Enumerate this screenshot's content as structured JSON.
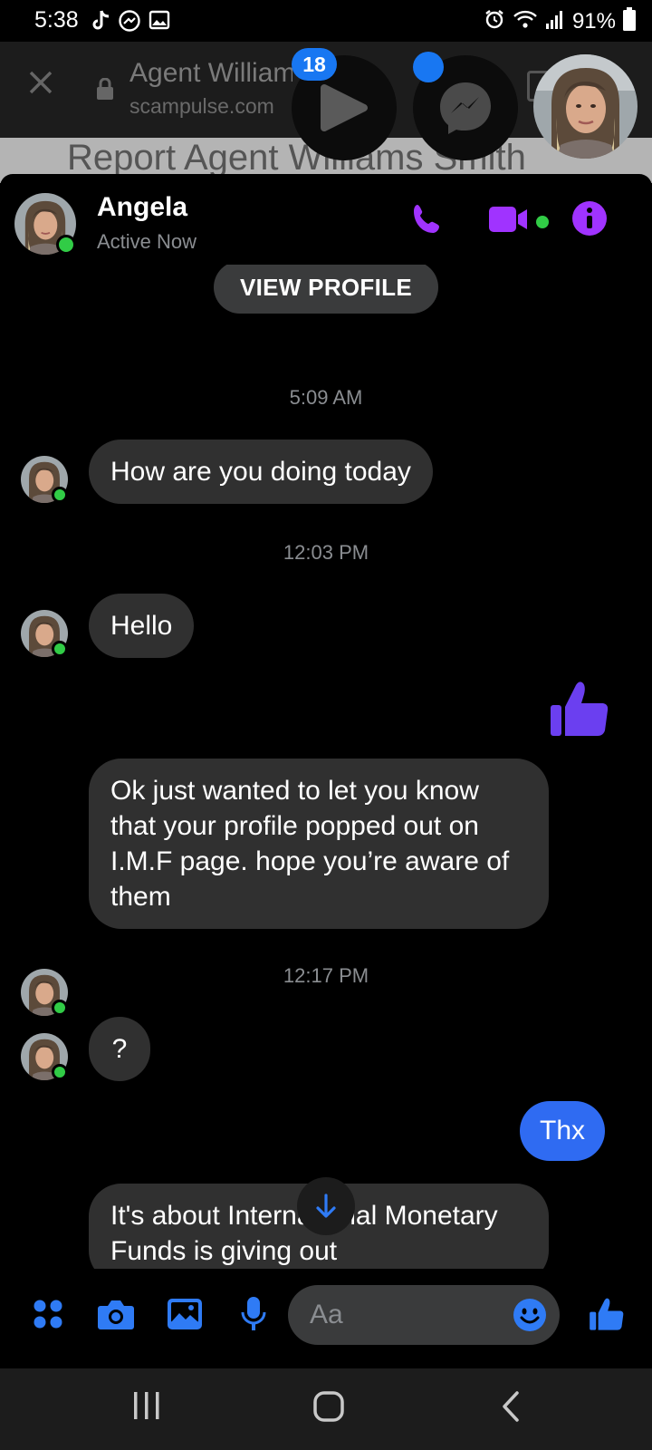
{
  "status_bar": {
    "time": "5:38",
    "battery": "91%",
    "left_icons": [
      "tiktok-icon",
      "messenger-icon",
      "image-icon"
    ],
    "right_icons": [
      "alarm-icon",
      "wifi-icon",
      "signal-icon",
      "battery-icon"
    ]
  },
  "browser": {
    "title": "Agent William",
    "url": "scampulse.com",
    "page_heading": "Report Agent Williams Smith"
  },
  "chat_heads": {
    "badge_count": "18"
  },
  "chat": {
    "contact_name": "Angela",
    "contact_status": "Active Now",
    "view_profile_label": "VIEW PROFILE",
    "accent_color": "#a033ff",
    "sent_color": "#2f6bf2",
    "received_color": "#303030",
    "online_color": "#31cc46",
    "messages": [
      {
        "type": "timestamp",
        "text": "5:09 AM"
      },
      {
        "type": "received",
        "text": "How are you doing today"
      },
      {
        "type": "timestamp",
        "text": "12:03 PM"
      },
      {
        "type": "received",
        "text": "Hello"
      },
      {
        "type": "sent_like",
        "icon": "thumbs-up-icon"
      },
      {
        "type": "received",
        "text": "Ok just wanted to let you know that your profile popped out on I.M.F page. hope you’re aware of them"
      },
      {
        "type": "timestamp",
        "text": "12:17 PM"
      },
      {
        "type": "received",
        "text": "?"
      },
      {
        "type": "sent",
        "text": "Thx"
      },
      {
        "type": "received",
        "text": "It's about International Monetary Funds is giving out"
      }
    ]
  },
  "composer": {
    "placeholder": "Aa",
    "buttons": [
      "apps-icon",
      "camera-icon",
      "gallery-icon",
      "microphone-icon",
      "emoji-icon",
      "thumbs-up-icon"
    ]
  },
  "nav_bar": {
    "buttons": [
      "recent-apps-icon",
      "home-icon",
      "back-icon"
    ]
  }
}
